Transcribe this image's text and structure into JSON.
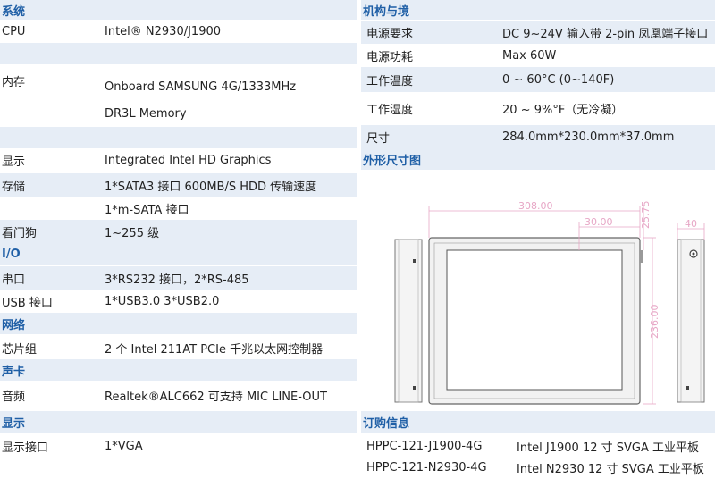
{
  "left": {
    "system_header": "系统",
    "cpu_label": "CPU",
    "cpu_value": "Intel® N2930/J1900",
    "memory_label": "内存",
    "memory_value_1": "Onboard SAMSUNG 4G/1333MHz",
    "memory_value_2": "DR3L Memory",
    "display_label": "显示",
    "display_value": "Integrated Intel HD Graphics",
    "storage_label": "存储",
    "storage_value_1": "1*SATA3 接口 600MB/S HDD 传输速度",
    "storage_value_2": "1*m-SATA 接口",
    "watchdog_label": "看门狗",
    "watchdog_value": "1~255 级",
    "io_header": "I/O",
    "serial_label": "串口",
    "serial_value": "3*RS232 接口，2*RS-485",
    "usb_label": "USB 接口",
    "usb_value": "1*USB3.0    3*USB2.0",
    "network_header": "网络",
    "chipset_label": "芯片组",
    "chipset_value": "2 个 Intel 211AT   PCIe 千兆以太网控制器",
    "sound_header": "声卡",
    "audio_label": "音频",
    "audio_value": "Realtek®ALC662 可支持 MIC LINE-OUT",
    "display_header": "显示",
    "display_port_label": "显示接口",
    "display_port_value": "1*VGA"
  },
  "right": {
    "mech_header": "机构与境",
    "power_req_label": "电源要求",
    "power_req_value": "DC 9~24V 输入带 2-pin 凤凰端子接口",
    "power_cons_label": "电源功耗",
    "power_cons_value": "Max    60W",
    "temp_label": "工作温度",
    "temp_value": "0    ~ 60°C  (0~140F)",
    "humidity_label": "工作湿度",
    "humidity_value": "20 ~ 9%°F（无冷凝）",
    "size_label": "尺寸",
    "size_value": "284.0mm*230.0mm*37.0mm",
    "drawing_header": "外形尺寸图",
    "order_header": "订购信息",
    "order_1_model": "HPPC-121-J1900-4G",
    "order_1_desc": "Intel J1900 12 寸 SVGA 工业平板",
    "order_2_model": "HPPC-121-N2930-4G",
    "order_2_desc": "Intel N2930 12 寸 SVGA 工业平板"
  },
  "drawing": {
    "dim_width": "308.00",
    "dim_right": "30.00",
    "dim_top": "25.75",
    "dim_height": "236.00",
    "dim_depth": "40"
  }
}
